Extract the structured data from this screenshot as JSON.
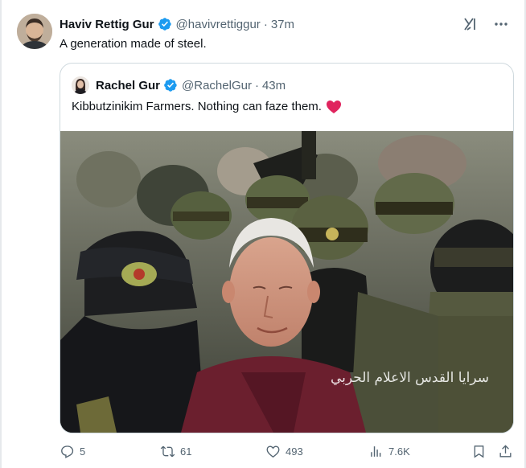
{
  "tweet": {
    "author_name": "Haviv Rettig Gur",
    "handle": "@havivrettiggur",
    "separator": "·",
    "time": "37m",
    "text": "A generation made of steel."
  },
  "quote": {
    "author_name": "Rachel Gur",
    "handle": "@RachelGur",
    "separator": "·",
    "time": "43m",
    "text": "Kibbutzinikim Farmers. Nothing can faze them.",
    "emoji": "heart-emoji",
    "photo_watermark": "سرايا القدس الاعلام الحربي"
  },
  "actions": {
    "replies": "5",
    "reposts": "61",
    "likes": "493",
    "views": "7.6K"
  },
  "icons": {
    "verified": "verified-badge-icon",
    "grok": "grok-icon",
    "more": "more-icon"
  },
  "colors": {
    "accent": "#1d9bf0",
    "text": "#0f1419",
    "muted": "#536471",
    "border": "#cfd9de",
    "heart": "#e0245e"
  }
}
